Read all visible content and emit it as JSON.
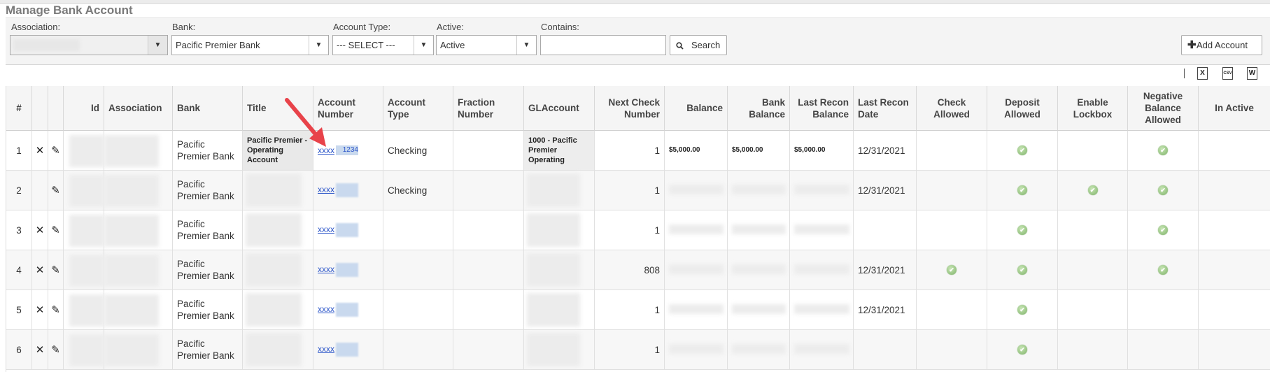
{
  "page": {
    "title": "Manage Bank Account"
  },
  "filters": {
    "association_label": "Association:",
    "association_value": "",
    "bank_label": "Bank:",
    "bank_value": "Pacific Premier Bank",
    "account_type_label": "Account Type:",
    "account_type_value": "--- SELECT ---",
    "active_label": "Active:",
    "active_value": "Active",
    "contains_label": "Contains:",
    "contains_value": "",
    "search_label": "Search",
    "add_account_label": "Add Account"
  },
  "export_icons": [
    "excel-icon",
    "csv-icon",
    "word-icon"
  ],
  "export_labels": {
    "excel": "X",
    "csv": "CSV",
    "word": "W"
  },
  "columns": {
    "num": "#",
    "id": "Id",
    "association": "Association",
    "bank": "Bank",
    "title": "Title",
    "account_number": "Account Number",
    "account_type": "Account Type",
    "fraction_number": "Fraction Number",
    "gl_account": "GLAccount",
    "next_check_number": "Next Check Number",
    "balance": "Balance",
    "bank_balance": "Bank Balance",
    "last_recon_balance": "Last Recon Balance",
    "last_recon_date": "Last Recon Date",
    "check_allowed": "Check Allowed",
    "deposit_allowed": "Deposit Allowed",
    "enable_lockbox": "Enable Lockbox",
    "negative_balance_allowed": "Negative Balance Allowed",
    "in_active": "In Active"
  },
  "rows": [
    {
      "num": "1",
      "bank": "Pacific Premier Bank",
      "title": "Pacific Premier - Operating Account",
      "account_number": "xxxx",
      "account_suffix": "1234",
      "account_type": "Checking",
      "gl_account": "1000 - Pacific Premier Operating",
      "next_check": "1",
      "balance": "$5,000.00",
      "bank_balance": "$5,000.00",
      "last_recon_balance": "$5,000.00",
      "last_recon_date": "12/31/2021",
      "check_allowed": false,
      "deposit_allowed": true,
      "enable_lockbox": false,
      "negative_balance_allowed": true,
      "has_delete": true
    },
    {
      "num": "2",
      "bank": "Pacific Premier Bank",
      "title": "",
      "account_number": "xxxx",
      "account_suffix": "",
      "account_type": "Checking",
      "gl_account": "",
      "next_check": "1",
      "balance": "",
      "bank_balance": "",
      "last_recon_balance": "",
      "last_recon_date": "12/31/2021",
      "check_allowed": false,
      "deposit_allowed": true,
      "enable_lockbox": true,
      "negative_balance_allowed": true,
      "has_delete": false
    },
    {
      "num": "3",
      "bank": "Pacific Premier Bank",
      "title": "",
      "account_number": "xxxx",
      "account_suffix": "",
      "account_type": "",
      "gl_account": "",
      "next_check": "1",
      "balance": "",
      "bank_balance": "",
      "last_recon_balance": "",
      "last_recon_date": "",
      "check_allowed": false,
      "deposit_allowed": true,
      "enable_lockbox": false,
      "negative_balance_allowed": true,
      "has_delete": true
    },
    {
      "num": "4",
      "bank": "Pacific Premier Bank",
      "title": "",
      "account_number": "xxxx",
      "account_suffix": "",
      "account_type": "",
      "gl_account": "",
      "next_check": "808",
      "balance": "",
      "bank_balance": "",
      "last_recon_balance": "",
      "last_recon_date": "12/31/2021",
      "check_allowed": true,
      "deposit_allowed": true,
      "enable_lockbox": false,
      "negative_balance_allowed": true,
      "has_delete": true
    },
    {
      "num": "5",
      "bank": "Pacific Premier Bank",
      "title": "",
      "account_number": "xxxx",
      "account_suffix": "",
      "account_type": "",
      "gl_account": "",
      "next_check": "1",
      "balance": "",
      "bank_balance": "",
      "last_recon_balance": "",
      "last_recon_date": "12/31/2021",
      "check_allowed": false,
      "deposit_allowed": true,
      "enable_lockbox": false,
      "negative_balance_allowed": false,
      "has_delete": true
    },
    {
      "num": "6",
      "bank": "Pacific Premier Bank",
      "title": "",
      "account_number": "xxxx",
      "account_suffix": "",
      "account_type": "",
      "gl_account": "",
      "next_check": "1",
      "balance": "",
      "bank_balance": "",
      "last_recon_balance": "",
      "last_recon_date": "",
      "check_allowed": false,
      "deposit_allowed": true,
      "enable_lockbox": false,
      "negative_balance_allowed": false,
      "has_delete": true
    }
  ],
  "colors": {
    "link": "#2b55c9",
    "check": "#7fb36a",
    "annotation_arrow": "#e8434a"
  }
}
